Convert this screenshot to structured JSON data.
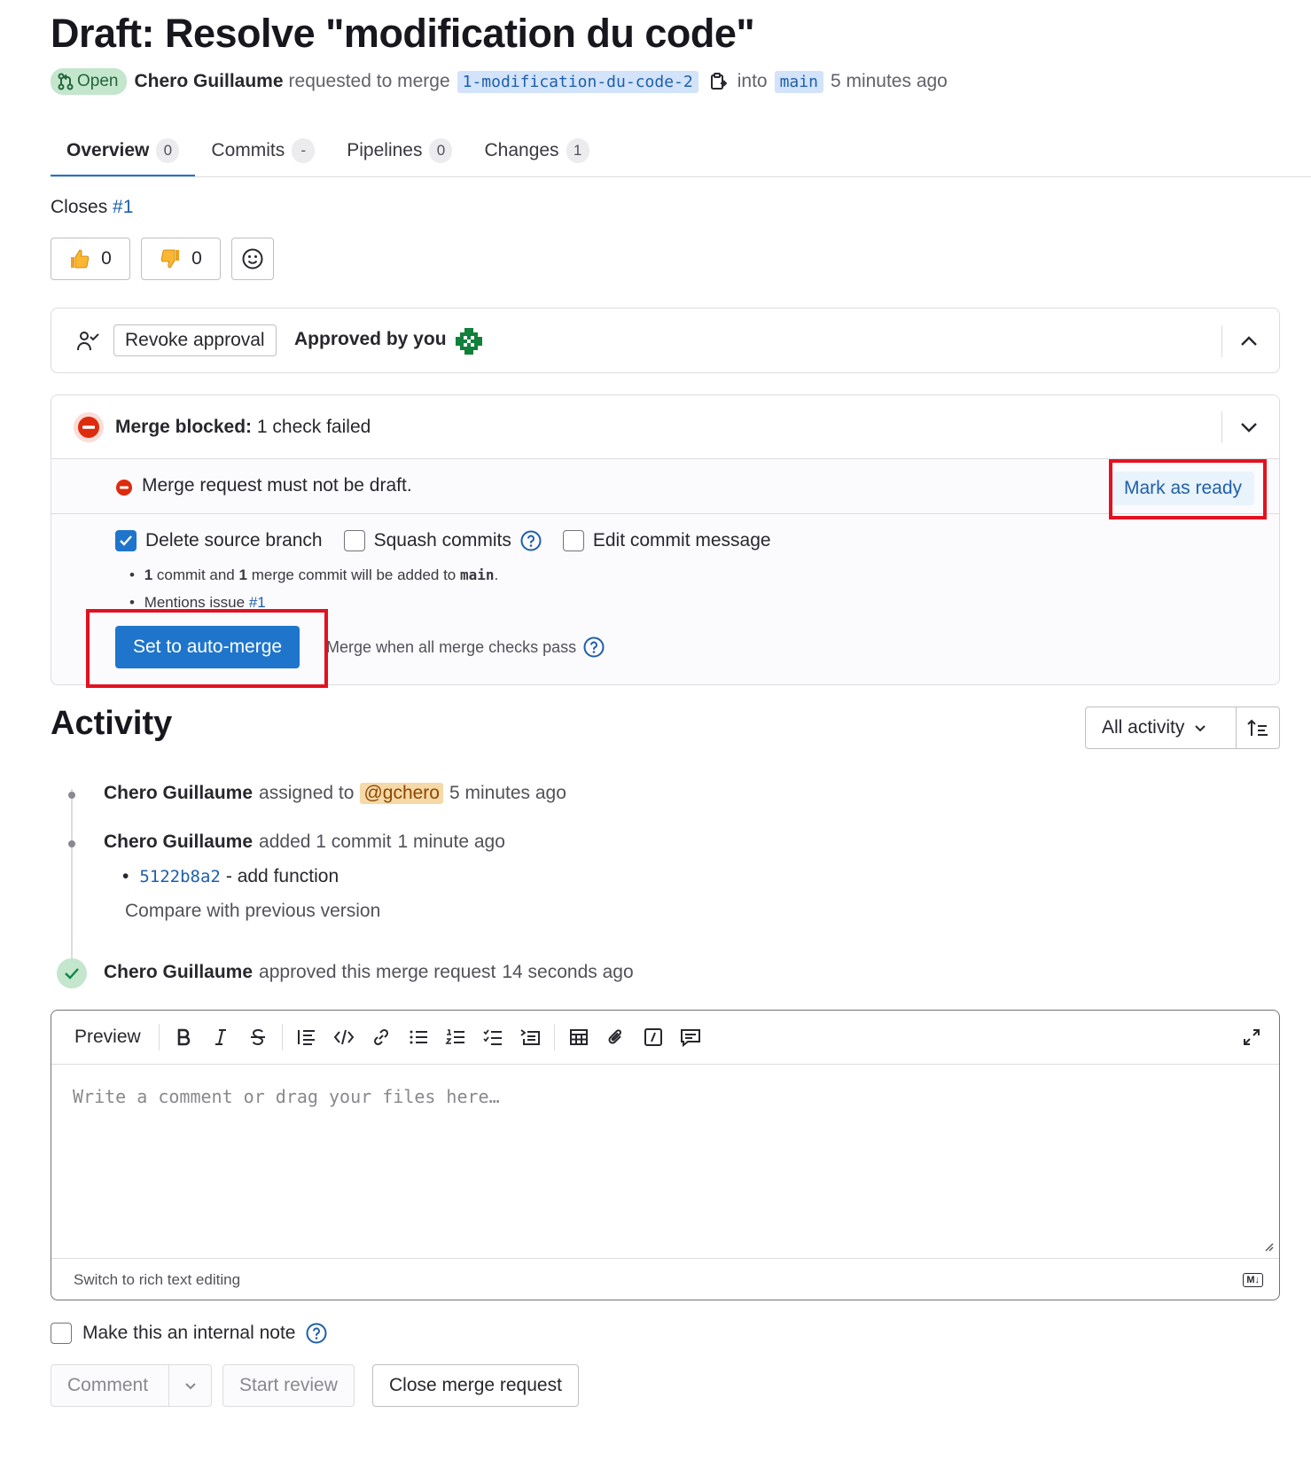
{
  "header": {
    "title": "Draft: Resolve \"modification du code\"",
    "status_badge": "Open",
    "author": "Chero Guillaume",
    "action_text": "requested to merge",
    "source_branch": "1-modification-du-code-2",
    "into_text": "into",
    "target_branch": "main",
    "time_ago": "5 minutes ago"
  },
  "tabs": [
    {
      "label": "Overview",
      "count": "0"
    },
    {
      "label": "Commits",
      "count": "-"
    },
    {
      "label": "Pipelines",
      "count": "0"
    },
    {
      "label": "Changes",
      "count": "1"
    }
  ],
  "closes": {
    "label": "Closes",
    "issue": "#1"
  },
  "reactions": {
    "thumbs_up_count": "0",
    "thumbs_down_count": "0"
  },
  "approval": {
    "revoke_label": "Revoke approval",
    "approved_text": "Approved by you"
  },
  "merge": {
    "blocked_label": "Merge blocked:",
    "blocked_detail": "1 check failed",
    "draft_message": "Merge request must not be draft.",
    "mark_ready_label": "Mark as ready",
    "delete_source_label": "Delete source branch",
    "delete_source_checked": true,
    "squash_label": "Squash commits",
    "squash_checked": false,
    "edit_message_label": "Edit commit message",
    "edit_message_checked": false,
    "bullet1": {
      "n1": "1",
      "t1": "commit and",
      "n2": "1",
      "t2": "merge commit will be added to",
      "branch": "main",
      "end": "."
    },
    "bullet2": {
      "text": "Mentions issue",
      "issue": "#1"
    },
    "automerge_label": "Set to auto-merge",
    "merge_when_text": "Merge when all merge checks pass"
  },
  "activity": {
    "title": "Activity",
    "filter_label": "All activity",
    "items": [
      {
        "author": "Chero Guillaume",
        "text": "assigned to",
        "mention": "@gchero",
        "time": "5 minutes ago"
      },
      {
        "author": "Chero Guillaume",
        "text": "added 1 commit",
        "time": "1 minute ago",
        "commit_sha": "5122b8a2",
        "commit_msg": "- add function",
        "compare_label": "Compare with previous version"
      },
      {
        "author": "Chero Guillaume",
        "text": "approved this merge request",
        "time": "14 seconds ago"
      }
    ]
  },
  "editor": {
    "preview_label": "Preview",
    "placeholder": "Write a comment or drag your files here…",
    "switch_label": "Switch to rich text editing",
    "markdown_badge": "M↓"
  },
  "footer": {
    "internal_note_label": "Make this an internal note",
    "comment_label": "Comment",
    "start_review_label": "Start review",
    "close_label": "Close merge request"
  },
  "colors": {
    "accent": "#1f75cb",
    "link": "#1f5faa",
    "danger": "#dd2b0e",
    "success": "#108548",
    "annotation": "#e3111f"
  }
}
